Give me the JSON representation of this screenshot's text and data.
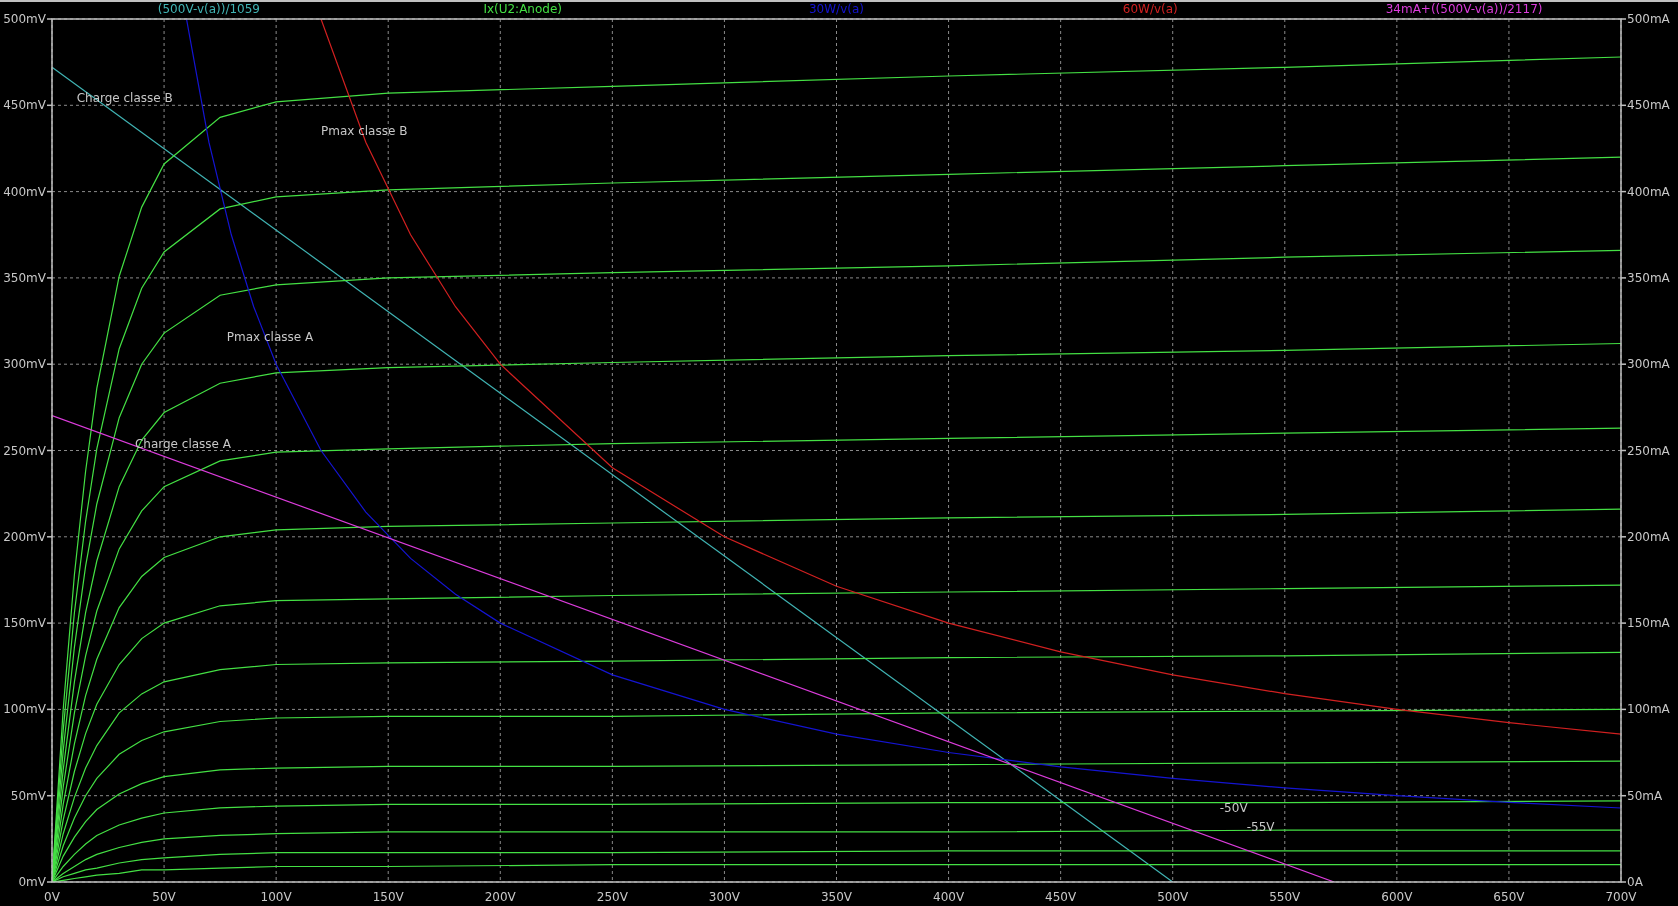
{
  "plot": {
    "chart_data": {
      "type": "line",
      "x": [
        0,
        5,
        10,
        15,
        20,
        30,
        40,
        50,
        75,
        100,
        150,
        250,
        400,
        550,
        700
      ],
      "xlim": [
        0,
        700
      ],
      "ylim": [
        0,
        500
      ],
      "y2lim": [
        0,
        500
      ],
      "grid": true,
      "xticks": [
        {
          "value": 0,
          "label": "0V"
        },
        {
          "value": 50,
          "label": "50V"
        },
        {
          "value": 100,
          "label": "100V"
        },
        {
          "value": 150,
          "label": "150V"
        },
        {
          "value": 200,
          "label": "200V"
        },
        {
          "value": 250,
          "label": "250V"
        },
        {
          "value": 300,
          "label": "300V"
        },
        {
          "value": 350,
          "label": "350V"
        },
        {
          "value": 400,
          "label": "400V"
        },
        {
          "value": 450,
          "label": "450V"
        },
        {
          "value": 500,
          "label": "500V"
        },
        {
          "value": 550,
          "label": "550V"
        },
        {
          "value": 600,
          "label": "600V"
        },
        {
          "value": 650,
          "label": "650V"
        },
        {
          "value": 700,
          "label": "700V"
        }
      ],
      "yticks": [
        {
          "value": 0,
          "label": "0mV"
        },
        {
          "value": 50,
          "label": "50mV"
        },
        {
          "value": 100,
          "label": "100mV"
        },
        {
          "value": 150,
          "label": "150mV"
        },
        {
          "value": 200,
          "label": "200mV"
        },
        {
          "value": 250,
          "label": "250mV"
        },
        {
          "value": 300,
          "label": "300mV"
        },
        {
          "value": 350,
          "label": "350mV"
        },
        {
          "value": 400,
          "label": "400mV"
        },
        {
          "value": 450,
          "label": "450mV"
        },
        {
          "value": 500,
          "label": "500mV"
        }
      ],
      "y2ticks": [
        {
          "value": 0,
          "label": "0A"
        },
        {
          "value": 50,
          "label": "50mA"
        },
        {
          "value": 100,
          "label": "100mA"
        },
        {
          "value": 150,
          "label": "150mA"
        },
        {
          "value": 200,
          "label": "200mA"
        },
        {
          "value": 250,
          "label": "250mA"
        },
        {
          "value": 300,
          "label": "300mA"
        },
        {
          "value": 350,
          "label": "350mA"
        },
        {
          "value": 400,
          "label": "400mA"
        },
        {
          "value": 450,
          "label": "450mA"
        },
        {
          "value": 500,
          "label": "500mA"
        }
      ],
      "series": [
        {
          "name": "(500V-v(a))/1059",
          "color": "#40b4b4",
          "x": [
            0,
            500
          ],
          "values": [
            472.1,
            0
          ]
        },
        {
          "name": "Ix(U2:Anode)",
          "color": "#44e044",
          "values": [
            0,
            100,
            178,
            238,
            286,
            351,
            391,
            416,
            443,
            452,
            457,
            461,
            467,
            472,
            478
          ]
        },
        {
          "color": "#44e044",
          "values": [
            0,
            88,
            156,
            209,
            251,
            309,
            344,
            365,
            390,
            397,
            401,
            405,
            410,
            415,
            420
          ]
        },
        {
          "color": "#44e044",
          "values": [
            0,
            76,
            136,
            183,
            219,
            269,
            300,
            318,
            340,
            346,
            350,
            353,
            357,
            362,
            366
          ]
        },
        {
          "color": "#44e044",
          "values": [
            0,
            65,
            116,
            156,
            186,
            229,
            256,
            272,
            289,
            295,
            298,
            301,
            305,
            308,
            312
          ]
        },
        {
          "color": "#44e044",
          "values": [
            0,
            55,
            98,
            131,
            157,
            193,
            215,
            229,
            244,
            249,
            251,
            254,
            257,
            260,
            263
          ]
        },
        {
          "color": "#44e044",
          "values": [
            0,
            45,
            80,
            108,
            129,
            159,
            177,
            188,
            200,
            204,
            206,
            208,
            211,
            213,
            216
          ]
        },
        {
          "color": "#44e044",
          "values": [
            0,
            36,
            64,
            86,
            103,
            126,
            141,
            150,
            160,
            163,
            164,
            166,
            168,
            170,
            172
          ]
        },
        {
          "color": "#44e044",
          "values": [
            0,
            28,
            49,
            66,
            79,
            98,
            109,
            116,
            123,
            126,
            127,
            128,
            130,
            131,
            133
          ]
        },
        {
          "color": "#44e044",
          "values": [
            0,
            21,
            37,
            50,
            60,
            74,
            82,
            87,
            93,
            95,
            96,
            96,
            98,
            99,
            100
          ]
        },
        {
          "color": "#44e044",
          "values": [
            0,
            15,
            26,
            35,
            42,
            51,
            57,
            61,
            65,
            66,
            67,
            67,
            68,
            69,
            70
          ]
        },
        {
          "color": "#44e044",
          "values": [
            0,
            9,
            16,
            22,
            27,
            33,
            37,
            40,
            43,
            44,
            45,
            45,
            46,
            46,
            47
          ]
        },
        {
          "color": "#44e044",
          "values": [
            0,
            5,
            9,
            13,
            16,
            20,
            23,
            25,
            27,
            28,
            29,
            29,
            29,
            30,
            30
          ]
        },
        {
          "color": "#44e044",
          "values": [
            0,
            3,
            5,
            7,
            8,
            11,
            13,
            14,
            16,
            17,
            17,
            17,
            18,
            18,
            18
          ]
        },
        {
          "color": "#44e044",
          "values": [
            0,
            1,
            2,
            3,
            4,
            5,
            7,
            7,
            8,
            9,
            9,
            10,
            10,
            10,
            10
          ]
        },
        {
          "name": "30W/v(a)",
          "color": "#1414d2",
          "x": [
            60,
            70,
            80,
            90,
            100,
            120,
            140,
            160,
            180,
            200,
            250,
            300,
            350,
            400,
            450,
            500,
            550,
            600,
            650,
            700
          ],
          "values": [
            500,
            428.6,
            375,
            333.3,
            300,
            250,
            214.3,
            187.5,
            166.7,
            150,
            120,
            100,
            85.7,
            75,
            66.7,
            60,
            54.5,
            50,
            46.2,
            42.9
          ]
        },
        {
          "name": "60W/v(a)",
          "color": "#d22020",
          "x": [
            120,
            140,
            160,
            180,
            200,
            250,
            300,
            350,
            400,
            450,
            500,
            550,
            600,
            650,
            700
          ],
          "values": [
            500,
            428.6,
            375,
            333.3,
            300,
            240,
            200,
            171.4,
            150,
            133.3,
            120,
            109.1,
            100,
            92.3,
            85.7
          ]
        },
        {
          "name": "34mA+((500V-v(a))/2117)",
          "color": "#dc3cdc",
          "x": [
            0,
            572
          ],
          "values": [
            270.2,
            0
          ]
        }
      ],
      "annotations": [
        "Charge classe B",
        "Pmax classe B",
        "Pmax classe A",
        "Charge classe A",
        "-50V",
        "-55V"
      ]
    }
  }
}
